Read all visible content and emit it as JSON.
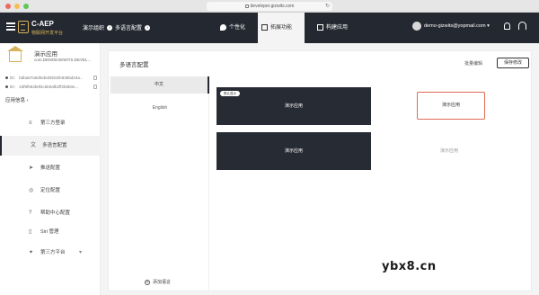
{
  "browser": {
    "url": "developer.gizwits.com"
  },
  "header": {
    "brand_title": "C-AEP",
    "brand_subtitle": "物联网开发平台",
    "breadcrumb": [
      "演示组织",
      "多语言配置"
    ],
    "tabs": [
      {
        "label": "个性化",
        "icon": "palette-icon"
      },
      {
        "label": "拓展功能",
        "icon": "grid-icon"
      },
      {
        "label": "构建应用",
        "icon": "box-icon"
      }
    ],
    "user": "demo-gizwits@yopmail.com"
  },
  "sidebar": {
    "app_name": "演示应用",
    "app_id": "com.DEMOEXEWITS.DEVEL...",
    "key1": "ID：  bdba67a0d0ebaf4b02fe8385d34a...",
    "key2": "ID：  23f9f063b9f4c6b0afb2ff2b5b0e...",
    "app_info": "应用信息",
    "items": [
      {
        "label": "第三方登录",
        "icon": "≡"
      },
      {
        "label": "多语言配置",
        "icon": "文"
      },
      {
        "label": "推送配置",
        "icon": "➤"
      },
      {
        "label": "定位配置",
        "icon": "◎"
      },
      {
        "label": "帮助中心配置",
        "icon": "?"
      },
      {
        "label": "Siri 管理",
        "icon": "▯"
      },
      {
        "label": "第三方平台",
        "icon": "✦"
      }
    ]
  },
  "main": {
    "title": "多语言配置",
    "action_link": "批量编辑",
    "save_label": "保存修改",
    "languages": [
      "中文",
      "English"
    ],
    "cards": [
      {
        "label": "演示应用",
        "badge": "默认显示",
        "style": "dark"
      },
      {
        "label": "演示应用",
        "style": "selected"
      },
      {
        "label": "演示应用",
        "style": "dark"
      },
      {
        "label": "演示应用",
        "style": "light"
      }
    ],
    "add_language": "添加语言"
  },
  "watermark": "ybx8.cn",
  "colors": {
    "header_bg": "#242831",
    "accent_gold": "#d8b25a",
    "selection_red": "#e06b57"
  }
}
